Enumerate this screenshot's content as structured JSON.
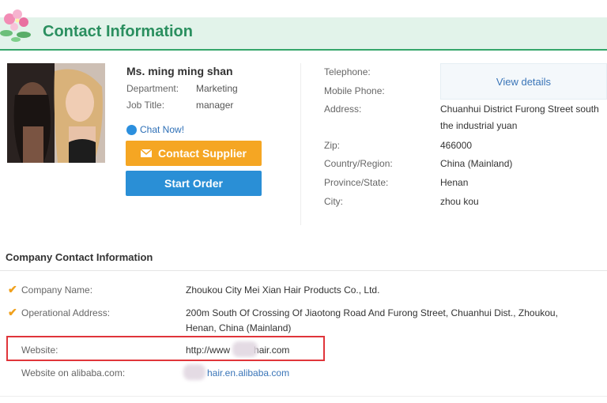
{
  "header": {
    "title": "Contact Information"
  },
  "contact": {
    "name": "Ms. ming ming shan",
    "department_label": "Department:",
    "department_value": "Marketing",
    "job_title_label": "Job Title:",
    "job_title_value": "manager",
    "chat_label": "Chat Now!",
    "contact_supplier_label": "Contact Supplier",
    "start_order_label": "Start Order"
  },
  "details": {
    "telephone_label": "Telephone:",
    "mobile_label": "Mobile Phone:",
    "view_details_label": "View details",
    "address_label": "Address:",
    "address_line1": "Chuanhui District Furong Street south",
    "address_line2": "the industrial yuan",
    "zip_label": "Zip:",
    "zip_value": "466000",
    "country_label": "Country/Region:",
    "country_value": "China (Mainland)",
    "province_label": "Province/State:",
    "province_value": "Henan",
    "city_label": "City:",
    "city_value": "zhou kou"
  },
  "company": {
    "section_title": "Company Contact Information",
    "name_label": "Company Name:",
    "name_value": "Zhoukou City Mei Xian Hair Products Co., Ltd.",
    "address_label": "Operational Address:",
    "address_line1": "200m South Of Crossing Of Jiaotong Road And Furong Street, Chuanhui Dist., Zhoukou,",
    "address_line2": "Henan, China (Mainland)",
    "website_label": "Website:",
    "website_prefix": "http://www",
    "website_suffix": "hair.com",
    "alibaba_label": "Website on alibaba.com:",
    "alibaba_value": "hair.en.alibaba.com"
  },
  "colors": {
    "header_accent": "#2a8f5f",
    "supplier_button": "#f5a623",
    "order_button": "#2a8fd6",
    "highlight_box": "#e0353a"
  }
}
